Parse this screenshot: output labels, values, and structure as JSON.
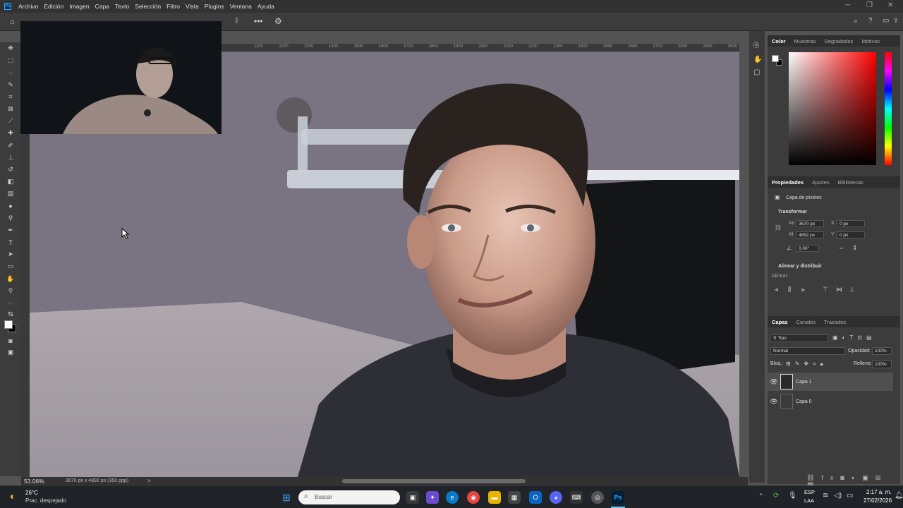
{
  "menu": {
    "logo": "Ps",
    "items": [
      "Archivo",
      "Edición",
      "Imagen",
      "Capa",
      "Texto",
      "Selección",
      "Filtro",
      "Vista",
      "Plugins",
      "Ventana",
      "Ayuda"
    ]
  },
  "ruler": {
    "ticks": [
      "1100",
      "1200",
      "1300",
      "1400",
      "1500",
      "1600",
      "1700",
      "1800",
      "1900",
      "2000",
      "2100",
      "2200",
      "2300",
      "2400",
      "2500",
      "2600",
      "2700",
      "2800",
      "2900",
      "3000"
    ]
  },
  "status": {
    "zoom": "53.06%",
    "doc_info": "3670 px x 4892 px (350 ppp)",
    "arrow": ">"
  },
  "color_panel": {
    "tabs": [
      "Color",
      "Muestras",
      "Degradados",
      "Motivos"
    ],
    "active_tab": "Color",
    "hue_color": "#ff0000",
    "foreground": "#ffffff",
    "background": "#000000"
  },
  "properties": {
    "tabs": [
      "Propiedades",
      "Ajustes",
      "Bibliotecas"
    ],
    "layer_type": "Capa de píxeles",
    "transform_title": "Transformar",
    "an_label": "An",
    "an_value": "3670 px",
    "al_label": "Al",
    "al_value": "4892 px",
    "x_label": "X",
    "x_value": "0 px",
    "y_label": "Y",
    "y_value": "0 px",
    "angle_value": "0,00°",
    "align_title": "Alinear y distribuir",
    "align_label": "Alinear:"
  },
  "layers": {
    "tabs": [
      "Capas",
      "Canales",
      "Trazados"
    ],
    "filter": "Tipo",
    "blend_mode": "Normal",
    "opacity_label": "Opacidad:",
    "opacity_value": "100%",
    "lock_label": "Bloq.:",
    "fill_label": "Relleno:",
    "fill_value": "100%",
    "items": [
      {
        "name": "Capa 1",
        "selected": true
      },
      {
        "name": "Capa 0",
        "selected": false
      }
    ]
  },
  "taskbar": {
    "weather_temp": "26°C",
    "weather_desc": "Prac. despejado",
    "search_placeholder": "Buscar",
    "lang_line1": "ESP",
    "lang_line2": "LAA",
    "time": "2:17 a. m.",
    "date": "27/02/2026",
    "ps_label": "Ps"
  }
}
